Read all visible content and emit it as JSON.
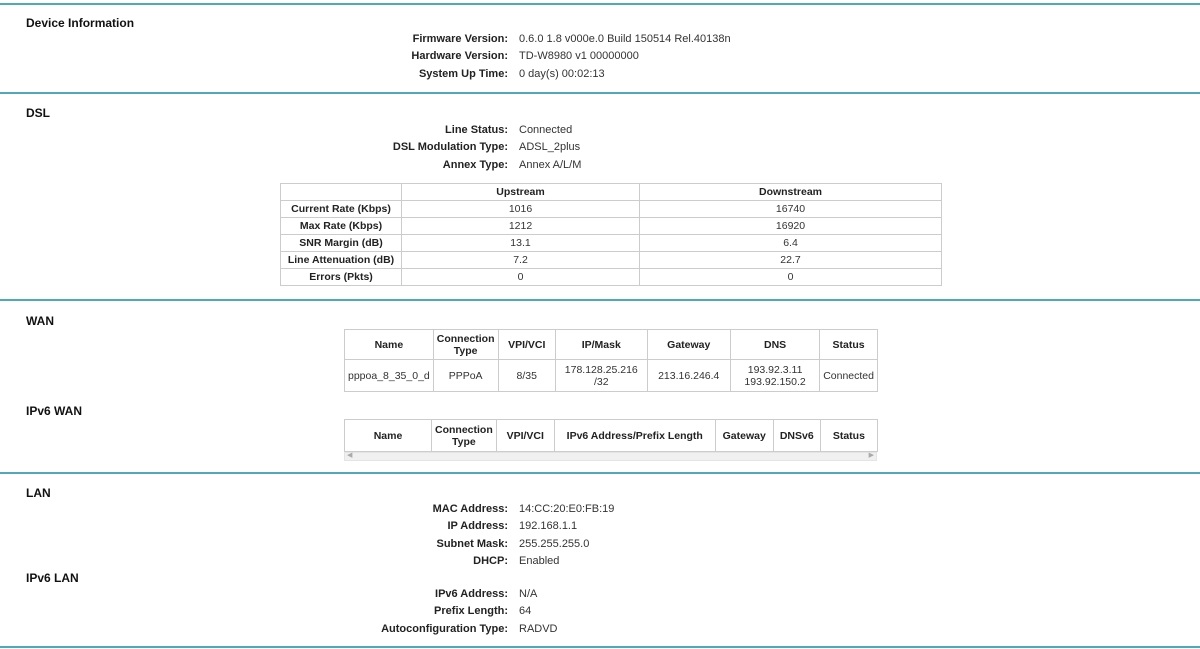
{
  "device": {
    "title": "Device Information",
    "rows": [
      {
        "label": "Firmware Version:",
        "value": "0.6.0 1.8 v000e.0 Build 150514 Rel.40138n"
      },
      {
        "label": "Hardware Version:",
        "value": "TD-W8980 v1 00000000"
      },
      {
        "label": "System Up Time:",
        "value": "0 day(s) 00:02:13"
      }
    ]
  },
  "dsl": {
    "title": "DSL",
    "rows": [
      {
        "label": "Line Status:",
        "value": "Connected"
      },
      {
        "label": "DSL Modulation Type:",
        "value": "ADSL_2plus"
      },
      {
        "label": "Annex Type:",
        "value": "Annex A/L/M"
      }
    ],
    "table": {
      "headers": [
        "",
        "Upstream",
        "Downstream"
      ],
      "rows": [
        [
          "Current Rate (Kbps)",
          "1016",
          "16740"
        ],
        [
          "Max Rate (Kbps)",
          "1212",
          "16920"
        ],
        [
          "SNR Margin (dB)",
          "13.1",
          "6.4"
        ],
        [
          "Line Attenuation (dB)",
          "7.2",
          "22.7"
        ],
        [
          "Errors (Pkts)",
          "0",
          "0"
        ]
      ]
    }
  },
  "wan": {
    "title": "WAN",
    "headers": [
      "Name",
      "Connection Type",
      "VPI/VCI",
      "IP/Mask",
      "Gateway",
      "DNS",
      "Status"
    ],
    "rows": [
      [
        "pppoa_8_35_0_d",
        "PPPoA",
        "8/35",
        "178.128.25.216 /32",
        "213.16.246.4",
        "193.92.3.11 193.92.150.2",
        "Connected"
      ]
    ]
  },
  "ipv6wan": {
    "title": "IPv6 WAN",
    "headers": [
      "Name",
      "Connection Type",
      "VPI/VCI",
      "IPv6 Address/Prefix Length",
      "Gateway",
      "DNSv6",
      "Status"
    ]
  },
  "lan": {
    "title": "LAN",
    "rows": [
      {
        "label": "MAC Address:",
        "value": "14:CC:20:E0:FB:19"
      },
      {
        "label": "IP Address:",
        "value": "192.168.1.1"
      },
      {
        "label": "Subnet Mask:",
        "value": "255.255.255.0"
      },
      {
        "label": "DHCP:",
        "value": "Enabled"
      }
    ]
  },
  "ipv6lan": {
    "title": "IPv6 LAN",
    "rows": [
      {
        "label": "IPv6 Address:",
        "value": "N/A"
      },
      {
        "label": "Prefix Length:",
        "value": "64"
      },
      {
        "label": "Autoconfiguration Type:",
        "value": "RADVD"
      }
    ]
  }
}
